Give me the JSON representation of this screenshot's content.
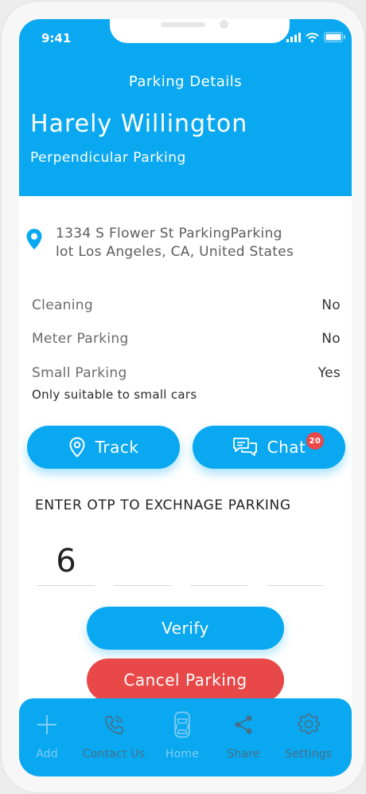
{
  "status_bar": {
    "time": "9:41"
  },
  "header": {
    "title": "Parking Details",
    "owner_name": "Harely Willington",
    "parking_type": "Perpendicular Parking"
  },
  "address": {
    "icon": "location-pin-icon",
    "line1": "1334 S Flower St ParkingParking",
    "line2": "lot Los Angeles, CA, United States"
  },
  "details": [
    {
      "label": "Cleaning",
      "value": "No"
    },
    {
      "label": "Meter Parking",
      "value": "No"
    },
    {
      "label": "Small Parking",
      "value": "Yes"
    }
  ],
  "note": "Only suitable to small cars",
  "actions": {
    "track_label": "Track",
    "chat_label": "Chat",
    "chat_badge": "20"
  },
  "otp": {
    "title": "ENTER OTP TO EXCHNAGE PARKING",
    "digits": [
      "6",
      "",
      "",
      ""
    ]
  },
  "buttons": {
    "verify": "Verify",
    "cancel": "Cancel Parking"
  },
  "tabbar": [
    {
      "label": "Add",
      "icon": "plus-icon"
    },
    {
      "label": "Contact Us",
      "icon": "phone-icon"
    },
    {
      "label": "Home",
      "icon": "car-icon"
    },
    {
      "label": "Share",
      "icon": "share-icon"
    },
    {
      "label": "Settings",
      "icon": "gear-icon"
    }
  ],
  "colors": {
    "primary": "#0aa8f0",
    "danger": "#e84848"
  }
}
